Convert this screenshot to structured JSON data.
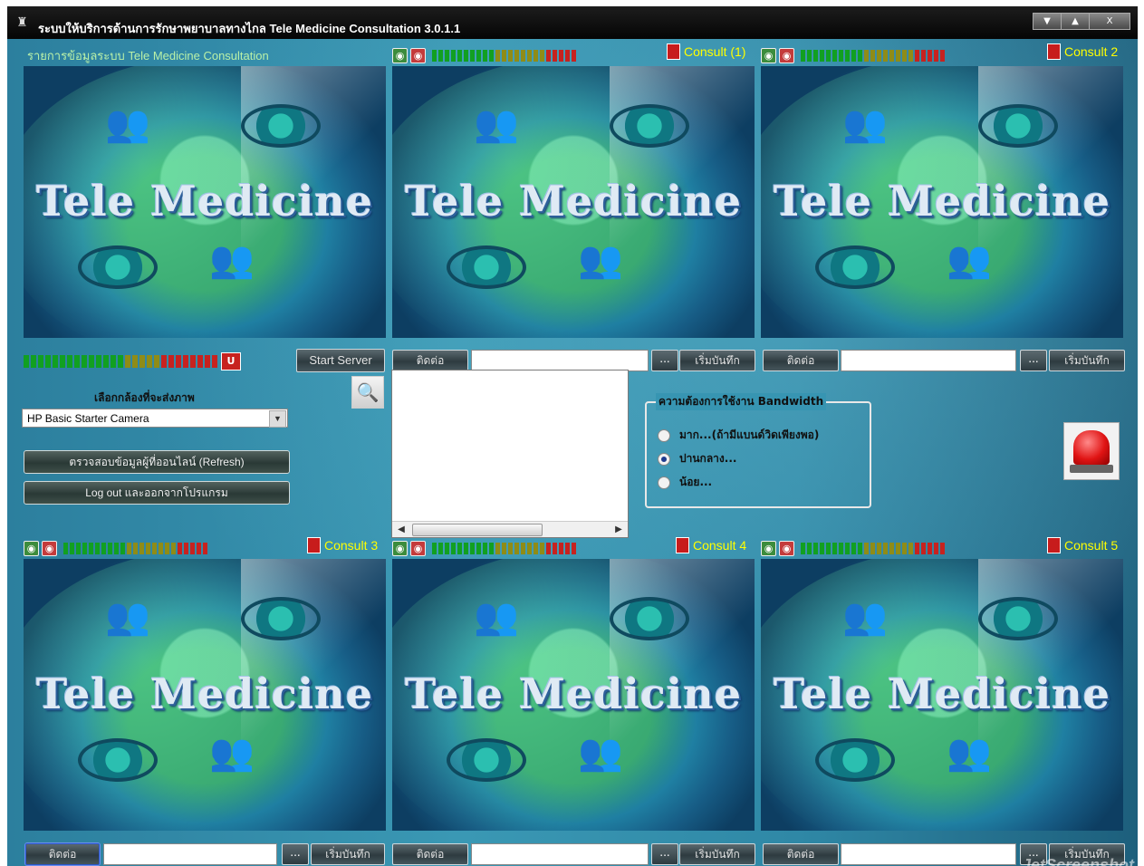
{
  "window": {
    "title": "ระบบให้บริการด้านการรักษาพยาบาลทางไกล Tele Medicine Consultation 3.0.1.1",
    "controls": {
      "minimize": "▼",
      "maximize": "▲",
      "close": "X"
    }
  },
  "info_label": "รายการข้อมูลระบบ Tele Medicine Consultation",
  "video_banner_text": "Tele Medicine",
  "panels": [
    {
      "consult_label": ""
    },
    {
      "consult_label": "Consult (1)"
    },
    {
      "consult_label": "Consult 2"
    },
    {
      "consult_label": "Consult 3"
    },
    {
      "consult_label": "Consult 4"
    },
    {
      "consult_label": "Consult 5"
    }
  ],
  "controls": {
    "start_server": "Start Server",
    "contact": "ติดต่อ",
    "browse": "...",
    "record": "เริ่มบันทึก"
  },
  "camera": {
    "label": "เลือกกล้องที่จะส่งภาพ",
    "selected": "HP Basic Starter Camera"
  },
  "buttons": {
    "refresh": "ตรวจสอบข้อมูลผู้ที่ออนไลน์ (Refresh)",
    "logout": "Log out และออกจากโปรแกรม"
  },
  "bandwidth": {
    "legend": "ความต้องการใช้งาน Bandwidth",
    "options": [
      {
        "label": "มาก...(ถ้ามีแบนด์วิดเพียงพอ)",
        "selected": false
      },
      {
        "label": "ปานกลาง...",
        "selected": true
      },
      {
        "label": "น้อย...",
        "selected": false
      }
    ]
  },
  "watermark": "JetScreenshot",
  "colors": {
    "accent_yellow": "#ffff00",
    "info_green": "#b9f0a8",
    "meter_green": "#11a021",
    "meter_yellow": "#8f8c17",
    "meter_red": "#c7221f"
  },
  "icons": [
    "camera-on-icon",
    "mic-on-icon",
    "record-icon",
    "search-icon",
    "alarm-siren-icon",
    "book-icon"
  ]
}
